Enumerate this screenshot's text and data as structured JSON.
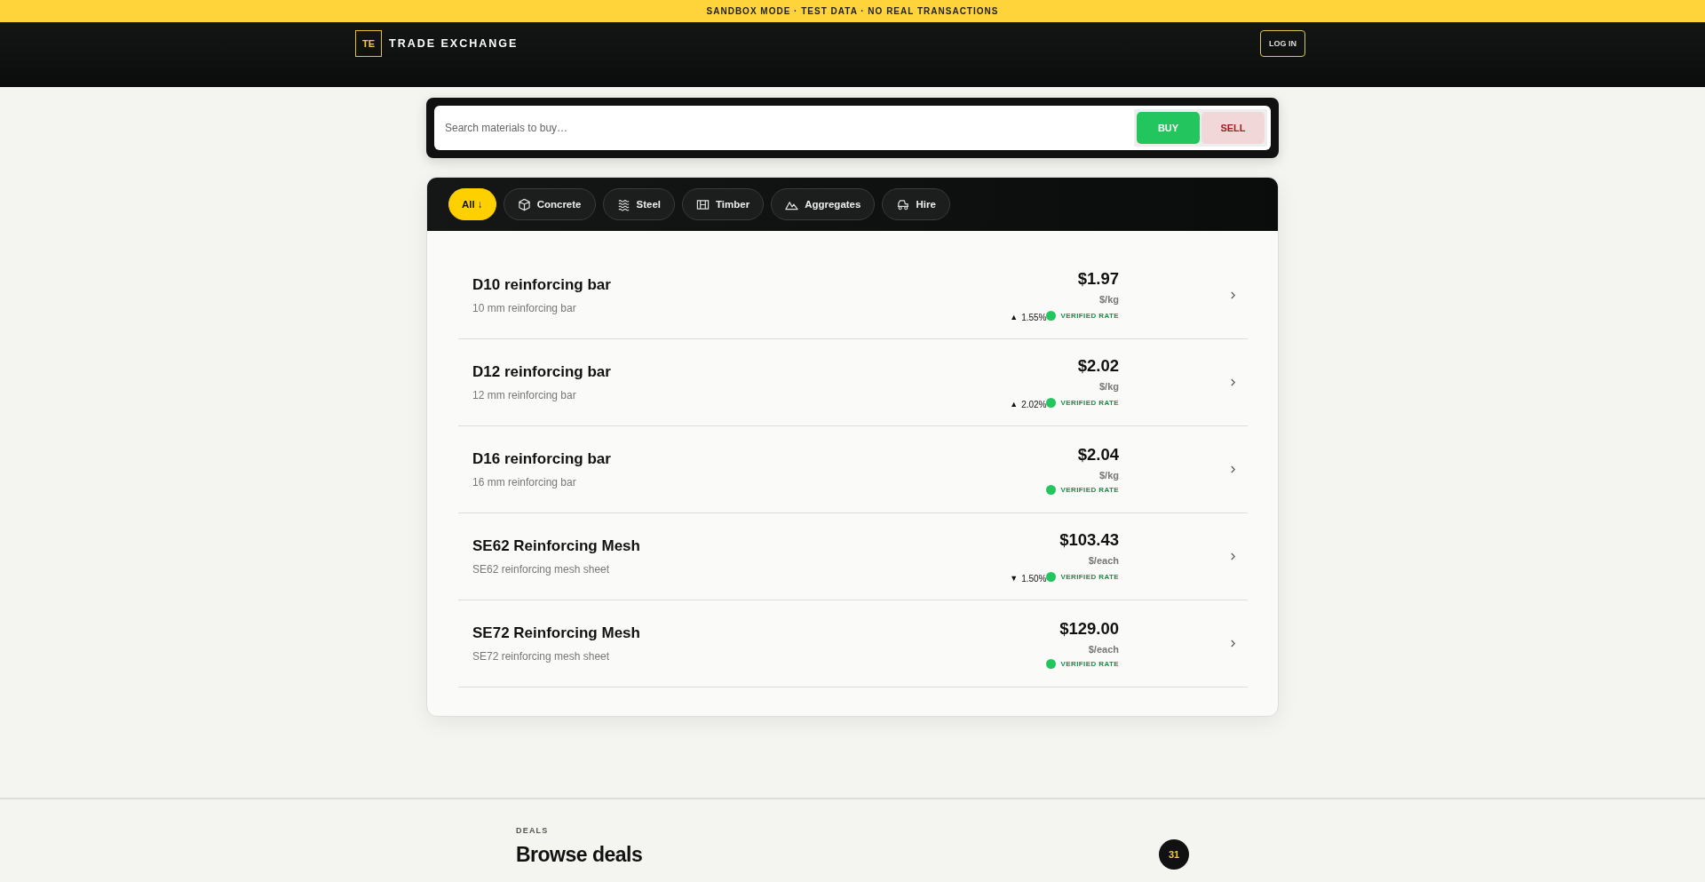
{
  "banner": {
    "text": "SANDBOX MODE · TEST DATA · NO REAL TRANSACTIONS"
  },
  "header": {
    "logo_mark": "TE",
    "brand": "TRADE EXCHANGE",
    "login": "LOG IN"
  },
  "search": {
    "placeholder": "Search materials to buy…",
    "modes": [
      {
        "label": "BUY",
        "selected": true
      },
      {
        "label": "SELL",
        "selected": false
      }
    ]
  },
  "categories": [
    {
      "label": "All ↓",
      "selected": true
    },
    {
      "label": "Concrete",
      "selected": false
    },
    {
      "label": "Steel",
      "selected": false
    },
    {
      "label": "Timber",
      "selected": false
    },
    {
      "label": "Aggregates",
      "selected": false
    },
    {
      "label": "Hire",
      "selected": false
    }
  ],
  "products": [
    {
      "name": "D10 reinforcing bar",
      "description": "10 mm reinforcing bar",
      "price": "$1.97",
      "unit": "$/kg",
      "change": {
        "arrow": "▲",
        "text": "1.55%"
      },
      "badge": "VERIFIED RATE"
    },
    {
      "name": "D12 reinforcing bar",
      "description": "12 mm reinforcing bar",
      "price": "$2.02",
      "unit": "$/kg",
      "change": {
        "arrow": "▲",
        "text": "2.02%"
      },
      "badge": "VERIFIED RATE"
    },
    {
      "name": "D16 reinforcing bar",
      "description": "16 mm reinforcing bar",
      "price": "$2.04",
      "unit": "$/kg",
      "badge": "VERIFIED RATE"
    },
    {
      "name": "SE62 Reinforcing Mesh",
      "description": "SE62 reinforcing mesh sheet",
      "price": "$103.43",
      "unit": "$/each",
      "change": {
        "arrow": "▼",
        "text": "1.50%"
      },
      "badge": "VERIFIED RATE"
    },
    {
      "name": "SE72 Reinforcing Mesh",
      "description": "SE72 reinforcing mesh sheet",
      "price": "$129.00",
      "unit": "$/each",
      "badge": "VERIFIED RATE"
    }
  ],
  "deals": {
    "eyebrow": "DEALS",
    "title": "Browse deals",
    "count": "31"
  }
}
